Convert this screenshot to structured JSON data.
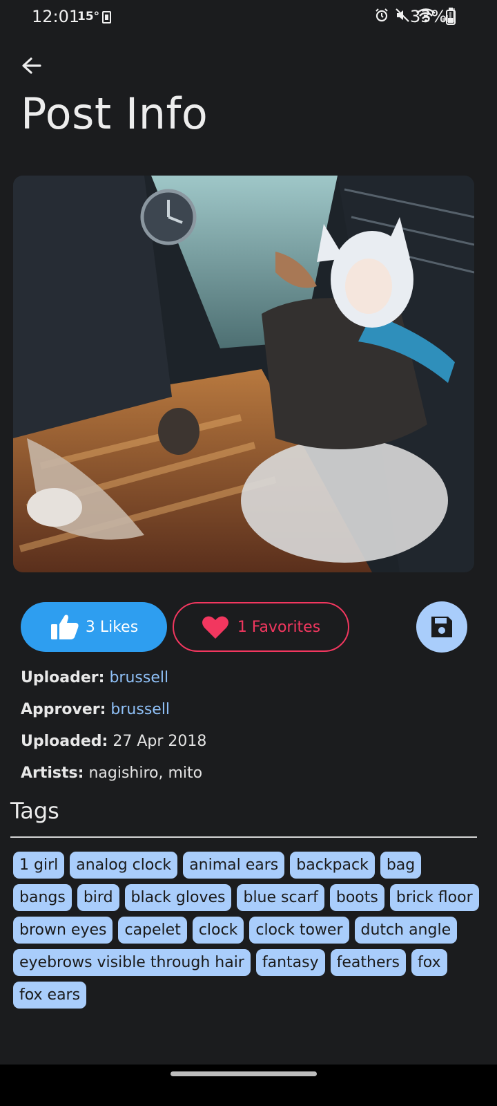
{
  "status_bar": {
    "time": "12:01",
    "temperature": "15°",
    "battery_percent": "33%",
    "icons": [
      "alarm-icon",
      "mute-icon",
      "wifi-icon",
      "signal-icon",
      "battery-icon"
    ]
  },
  "header": {
    "title": "Post Info",
    "back_icon": "arrow-left-icon"
  },
  "actions": {
    "likes_label": "3 Likes",
    "favorites_label": "1 Favorites",
    "save_icon": "floppy-disk-icon"
  },
  "info": {
    "uploader_label": "Uploader:",
    "uploader_value": "brussell",
    "approver_label": "Approver:",
    "approver_value": "brussell",
    "uploaded_label": "Uploaded:",
    "uploaded_value": "27 Apr 2018",
    "artists_label": "Artists:",
    "artists_value": "nagishiro, mito"
  },
  "tags": {
    "title": "Tags",
    "items": [
      "1 girl",
      "analog clock",
      "animal ears",
      "backpack",
      "bag",
      "bangs",
      "bird",
      "black gloves",
      "blue scarf",
      "boots",
      "brick floor",
      "brown eyes",
      "capelet",
      "clock",
      "clock tower",
      "dutch angle",
      "eyebrows visible through hair",
      "fantasy",
      "feathers",
      "fox",
      "fox ears"
    ]
  },
  "colors": {
    "background": "#1b1c1e",
    "likes": "#2e9ef0",
    "favorites": "#f2375f",
    "tag_bg": "#a9cdfb",
    "link": "#8fc0f7"
  }
}
